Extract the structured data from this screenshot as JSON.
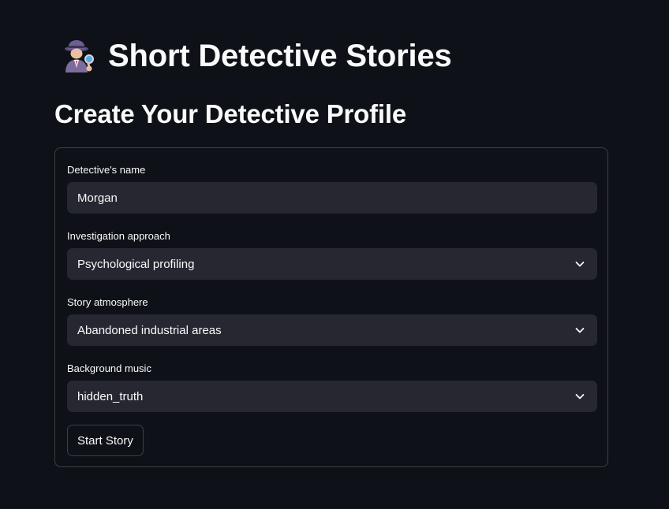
{
  "header": {
    "title": "Short Detective Stories",
    "icon": "detective-icon"
  },
  "form": {
    "section_title": "Create Your Detective Profile",
    "fields": [
      {
        "label": "Detective's name",
        "value": "Morgan",
        "kind": "text-input"
      },
      {
        "label": "Investigation approach",
        "value": "Psychological profiling",
        "kind": "select"
      },
      {
        "label": "Story atmosphere",
        "value": "Abandoned industrial areas",
        "kind": "select"
      },
      {
        "label": "Background music",
        "value": "hidden_truth",
        "kind": "select"
      }
    ],
    "submit_label": "Start Story"
  },
  "colors": {
    "background": "#0e1117",
    "input_background": "#262730",
    "text": "#fafafa",
    "border": "rgba(250,250,250,0.2)"
  }
}
